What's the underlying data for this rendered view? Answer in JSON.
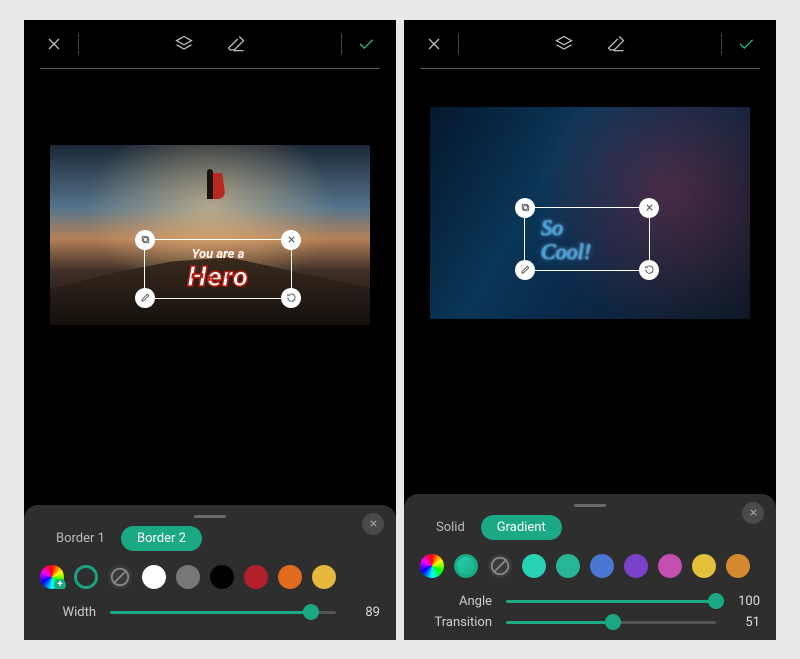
{
  "accent": "#1aa984",
  "left": {
    "text_top": "You are a",
    "text_main": "Hero",
    "tabs": [
      {
        "label": "Border 1",
        "active": false
      },
      {
        "label": "Border 2",
        "active": true
      }
    ],
    "swatches": [
      "#ffffff",
      "#777777",
      "#000000",
      "#b5212b",
      "#e06b1f",
      "#e6b93d"
    ],
    "slider": {
      "label": "Width",
      "value": 89,
      "max": 100
    }
  },
  "right": {
    "text_line1": "So",
    "text_line2": "Cool!",
    "tabs": [
      {
        "label": "Solid",
        "active": false
      },
      {
        "label": "Gradient",
        "active": true
      }
    ],
    "swatches": [
      "#28d3b4",
      "#27b696",
      "#4a77d4",
      "#7a42c8",
      "#c44fb1",
      "#e2c23a",
      "#d48a2f"
    ],
    "sliders": [
      {
        "label": "Angle",
        "value": 100,
        "max": 100
      },
      {
        "label": "Transition",
        "value": 51,
        "max": 100
      }
    ]
  }
}
